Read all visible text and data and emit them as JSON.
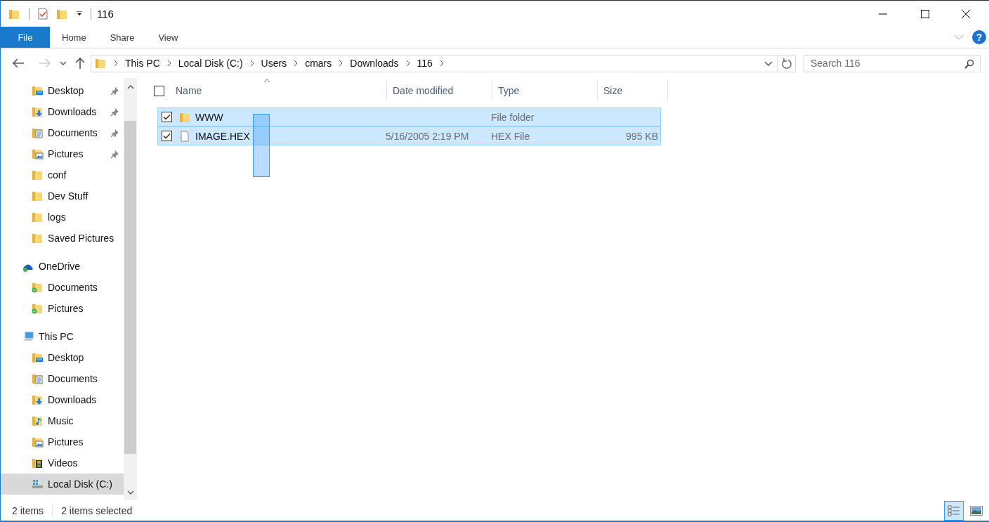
{
  "window": {
    "title": "116"
  },
  "ribbon": {
    "tabs": [
      {
        "label": "File",
        "kind": "menu"
      },
      {
        "label": "Home",
        "kind": "tab"
      },
      {
        "label": "Share",
        "kind": "tab"
      },
      {
        "label": "View",
        "kind": "tab"
      }
    ],
    "help": "?"
  },
  "address": {
    "crumbs": [
      "This PC",
      "Local Disk (C:)",
      "Users",
      "cmars",
      "Downloads",
      "116"
    ],
    "search": {
      "placeholder": "Search 116"
    }
  },
  "nav": {
    "quick_access": [
      {
        "label": "Desktop",
        "kind": "desktop",
        "pinned": true,
        "selected": false
      },
      {
        "label": "Downloads",
        "kind": "downloads",
        "pinned": true,
        "selected": false
      },
      {
        "label": "Documents",
        "kind": "documents",
        "pinned": true,
        "selected": false
      },
      {
        "label": "Pictures",
        "kind": "pictures",
        "pinned": true,
        "selected": false
      },
      {
        "label": "conf",
        "kind": "folder",
        "pinned": false,
        "selected": false
      },
      {
        "label": "Dev Stuff",
        "kind": "folder",
        "pinned": false,
        "selected": false
      },
      {
        "label": "logs",
        "kind": "folder",
        "pinned": false,
        "selected": false
      },
      {
        "label": "Saved Pictures",
        "kind": "folder",
        "pinned": false,
        "selected": false
      }
    ],
    "trees": [
      {
        "label": "OneDrive",
        "kind": "cloud",
        "selected": false,
        "children": [
          {
            "label": "Documents",
            "kind": "synced",
            "selected": false
          },
          {
            "label": "Pictures",
            "kind": "synced",
            "selected": false
          }
        ]
      },
      {
        "label": "This PC",
        "kind": "computer",
        "selected": false,
        "children": [
          {
            "label": "Desktop",
            "kind": "desktop",
            "selected": false
          },
          {
            "label": "Documents",
            "kind": "documents",
            "selected": false
          },
          {
            "label": "Downloads",
            "kind": "downloads",
            "selected": false
          },
          {
            "label": "Music",
            "kind": "music",
            "selected": false
          },
          {
            "label": "Pictures",
            "kind": "pictures",
            "selected": false
          },
          {
            "label": "Videos",
            "kind": "videos",
            "selected": false
          },
          {
            "label": "Local Disk (C:)",
            "kind": "drive",
            "selected": true
          }
        ]
      }
    ]
  },
  "files": {
    "select_all_checked": false,
    "columns": [
      "Name",
      "Date modified",
      "Type",
      "Size"
    ],
    "rows": [
      {
        "kind": "folder",
        "name": "WWW",
        "date": "",
        "type": "File folder",
        "size": "",
        "checked": true,
        "selected": true
      },
      {
        "kind": "file",
        "name": "IMAGE.HEX",
        "date": "5/16/2005 2:19 PM",
        "type": "HEX File",
        "size": "995 KB",
        "checked": true,
        "selected": true
      }
    ]
  },
  "status_bar": {
    "count": "2 items",
    "selection": "2 items selected",
    "views": [
      {
        "kind": "details",
        "selected": true
      },
      {
        "kind": "large-icons",
        "selected": false
      }
    ]
  }
}
